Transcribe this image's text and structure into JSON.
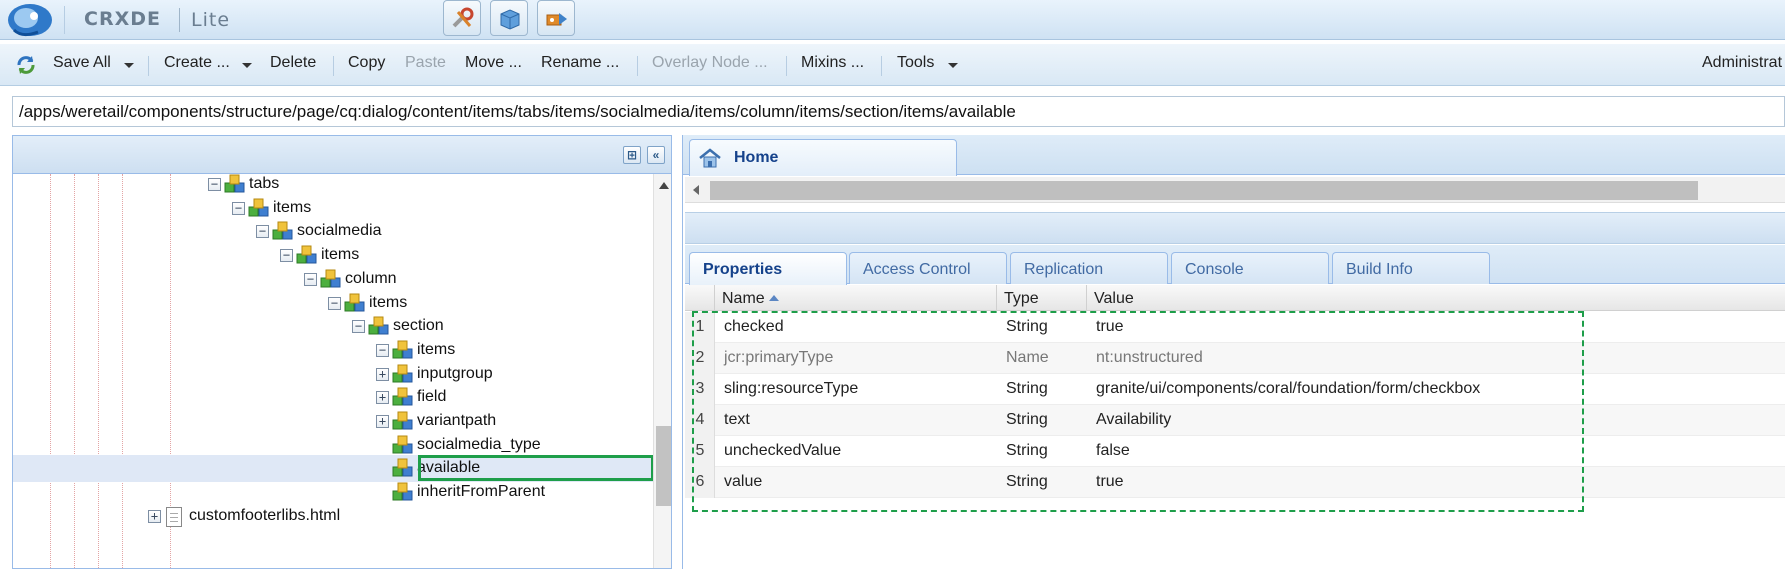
{
  "app": {
    "title": "CRXDE",
    "subtitle": "Lite",
    "user": "Administrat"
  },
  "header_buttons": [
    {
      "icon": "tools-icon"
    },
    {
      "icon": "package-icon"
    },
    {
      "icon": "share-icon"
    }
  ],
  "toolbar": {
    "save_all": "Save All",
    "create": "Create ...",
    "delete": "Delete",
    "copy": "Copy",
    "paste": "Paste",
    "move": "Move ...",
    "rename": "Rename ...",
    "overlay_node": "Overlay Node ...",
    "mixins": "Mixins ...",
    "tools": "Tools"
  },
  "path": "/apps/weretail/components/structure/page/cq:dialog/content/items/tabs/items/socialmedia/items/column/items/section/items/available",
  "tree": {
    "nodes": [
      {
        "label": "tabs",
        "expander": "minus"
      },
      {
        "label": "items",
        "expander": "minus"
      },
      {
        "label": "socialmedia",
        "expander": "minus"
      },
      {
        "label": "items",
        "expander": "minus"
      },
      {
        "label": "column",
        "expander": "minus"
      },
      {
        "label": "items",
        "expander": "minus"
      },
      {
        "label": "section",
        "expander": "minus"
      },
      {
        "label": "items",
        "expander": "minus"
      },
      {
        "label": "inputgroup",
        "expander": "plus"
      },
      {
        "label": "field",
        "expander": "plus"
      },
      {
        "label": "variantpath",
        "expander": "plus"
      },
      {
        "label": "socialmedia_type",
        "expander": "none"
      },
      {
        "label": "available",
        "expander": "none",
        "selected": true
      },
      {
        "label": "inheritFromParent",
        "expander": "none"
      },
      {
        "label": "customfooterlibs.html",
        "expander": "plus",
        "type": "file"
      }
    ]
  },
  "right": {
    "home_tab": "Home",
    "tabs": [
      "Properties",
      "Access Control",
      "Replication",
      "Console",
      "Build Info"
    ],
    "active_tab": "Properties",
    "columns": {
      "name": "Name",
      "type": "Type",
      "value": "Value"
    },
    "rows": [
      {
        "num": "1",
        "name": "checked",
        "type": "String",
        "value": "true"
      },
      {
        "num": "2",
        "name": "jcr:primaryType",
        "type": "Name",
        "value": "nt:unstructured"
      },
      {
        "num": "3",
        "name": "sling:resourceType",
        "type": "String",
        "value": "granite/ui/components/coral/foundation/form/checkbox"
      },
      {
        "num": "4",
        "name": "text",
        "type": "String",
        "value": "Availability"
      },
      {
        "num": "5",
        "name": "uncheckedValue",
        "type": "String",
        "value": "false"
      },
      {
        "num": "6",
        "name": "value",
        "type": "String",
        "value": "true"
      }
    ]
  },
  "colors": {
    "selection_outline": "#1e9e4a",
    "header_bg": "#dfecf8",
    "tab_text": "#15428b"
  }
}
